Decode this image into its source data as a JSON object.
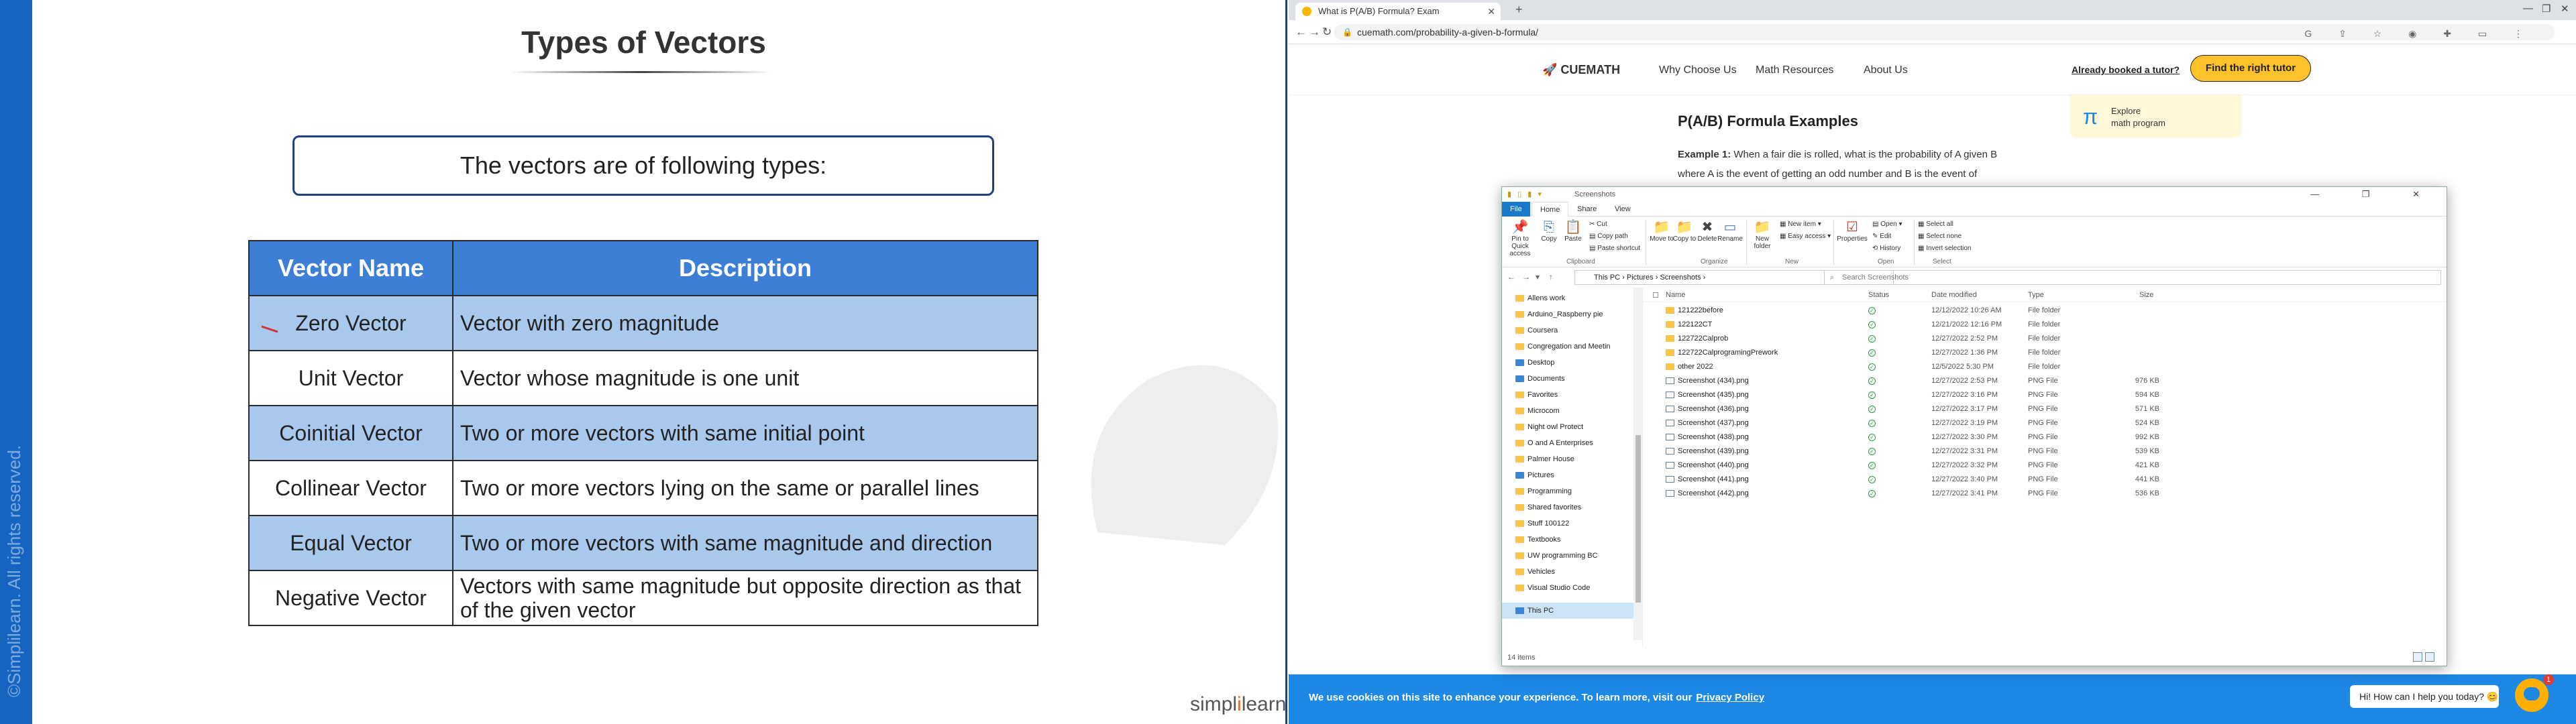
{
  "slide": {
    "title": "Types of Vectors",
    "intro": "The vectors are of following types:",
    "headers": [
      "Vector Name",
      "Description"
    ],
    "rows": [
      {
        "name": "Zero Vector",
        "desc": "Vector with zero magnitude"
      },
      {
        "name": "Unit Vector",
        "desc": "Vector whose magnitude is one unit"
      },
      {
        "name": "Coinitial Vector",
        "desc": "Two or more vectors with same initial point"
      },
      {
        "name": "Collinear Vector",
        "desc": "Two or more vectors lying on the same or parallel lines"
      },
      {
        "name": "Equal Vector",
        "desc": "Two or more vectors with same magnitude and direction"
      },
      {
        "name": "Negative Vector",
        "desc": "Vectors with same magnitude but opposite direction as that of the given vector"
      }
    ],
    "watermark": "©Simplilearn. All rights reserved.",
    "logo_a": "simpl",
    "logo_b": "i",
    "logo_c": "learn",
    "colors": {
      "header": "#3d7fd6",
      "shade": "#a8c8ec",
      "band": "#1565c0"
    }
  },
  "browser": {
    "tab_title": "What is P(A/B) Formula? Exam",
    "url": "cuemath.com/probability-a-given-b-formula/",
    "site": {
      "logo": "CUEMATH",
      "nav": [
        "Why Choose Us",
        "Math Resources",
        "About Us"
      ],
      "booked_link": "Already booked a tutor?",
      "cta": "Find the right tutor",
      "explore_1": "Explore",
      "explore_2": "math program",
      "heading": "P(A/B) Formula Examples",
      "example_label": "Example 1:",
      "example_text": "When a fair die is rolled, what is the probability of A given B where A is the event of getting an odd number and B is the event of"
    },
    "cookie_msg": "We use cookies on this site to enhance your experience. To learn more, visit our",
    "cookie_link": "Privacy Policy",
    "chat_prompt": "Hi! How can I help you today? 😊",
    "chat_badge": "1"
  },
  "explorer": {
    "title": "Screenshots",
    "ribbon_tabs": [
      "File",
      "Home",
      "Share",
      "View"
    ],
    "ribbon": {
      "pin": "Pin to Quick access",
      "copy": "Copy",
      "paste": "Paste",
      "cut": "Cut",
      "copy_path": "Copy path",
      "paste_shortcut": "Paste shortcut",
      "move_to": "Move to",
      "copy_to": "Copy to",
      "delete": "Delete",
      "rename": "Rename",
      "new_folder": "New folder",
      "new_item": "New item",
      "easy_access": "Easy access",
      "properties": "Properties",
      "open": "Open",
      "edit": "Edit",
      "history": "History",
      "select_all": "Select all",
      "select_none": "Select none",
      "invert": "Invert selection",
      "groups": [
        "Clipboard",
        "Organize",
        "New",
        "Open",
        "Select"
      ]
    },
    "path": [
      "This PC",
      "Pictures",
      "Screenshots"
    ],
    "search_placeholder": "Search Screenshots",
    "nav_items": [
      {
        "label": "Allens work",
        "icon": "folder"
      },
      {
        "label": "Arduino_Raspberry pie",
        "icon": "folder"
      },
      {
        "label": "Coursera",
        "icon": "folder"
      },
      {
        "label": "Congregation and Meetin",
        "icon": "folder"
      },
      {
        "label": "Desktop",
        "icon": "desktop"
      },
      {
        "label": "Documents",
        "icon": "documents"
      },
      {
        "label": "Favorites",
        "icon": "folder"
      },
      {
        "label": "Microcom",
        "icon": "folder"
      },
      {
        "label": "Night owl Protect",
        "icon": "folder"
      },
      {
        "label": "O and A Enterprises",
        "icon": "folder"
      },
      {
        "label": "Palmer House",
        "icon": "folder"
      },
      {
        "label": "Pictures",
        "icon": "pictures"
      },
      {
        "label": "Programming",
        "icon": "folder"
      },
      {
        "label": "Shared favorites",
        "icon": "folder"
      },
      {
        "label": "Stuff 100122",
        "icon": "folder"
      },
      {
        "label": "Textbooks",
        "icon": "folder"
      },
      {
        "label": "UW programming BC",
        "icon": "folder"
      },
      {
        "label": "Vehicles",
        "icon": "folder"
      },
      {
        "label": "Visual Studio Code",
        "icon": "folder"
      },
      {
        "label": "This PC",
        "icon": "pc"
      }
    ],
    "columns": [
      "Name",
      "Status",
      "Date modified",
      "Type",
      "Size"
    ],
    "files": [
      {
        "name": "121222before",
        "date": "12/12/2022 10:26 AM",
        "type": "File folder",
        "size": "",
        "kind": "folder"
      },
      {
        "name": "122122CT",
        "date": "12/21/2022 12:16 PM",
        "type": "File folder",
        "size": "",
        "kind": "folder"
      },
      {
        "name": "122722Calprob",
        "date": "12/27/2022 2:52 PM",
        "type": "File folder",
        "size": "",
        "kind": "folder"
      },
      {
        "name": "122722CalprogramingPrework",
        "date": "12/27/2022 1:36 PM",
        "type": "File folder",
        "size": "",
        "kind": "folder"
      },
      {
        "name": "other 2022",
        "date": "12/5/2022 5:30 PM",
        "type": "File folder",
        "size": "",
        "kind": "folder"
      },
      {
        "name": "Screenshot (434).png",
        "date": "12/27/2022 2:53 PM",
        "type": "PNG File",
        "size": "976 KB",
        "kind": "png"
      },
      {
        "name": "Screenshot (435).png",
        "date": "12/27/2022 3:16 PM",
        "type": "PNG File",
        "size": "594 KB",
        "kind": "png"
      },
      {
        "name": "Screenshot (436).png",
        "date": "12/27/2022 3:17 PM",
        "type": "PNG File",
        "size": "571 KB",
        "kind": "png"
      },
      {
        "name": "Screenshot (437).png",
        "date": "12/27/2022 3:19 PM",
        "type": "PNG File",
        "size": "524 KB",
        "kind": "png"
      },
      {
        "name": "Screenshot (438).png",
        "date": "12/27/2022 3:30 PM",
        "type": "PNG File",
        "size": "992 KB",
        "kind": "png"
      },
      {
        "name": "Screenshot (439).png",
        "date": "12/27/2022 3:31 PM",
        "type": "PNG File",
        "size": "539 KB",
        "kind": "png"
      },
      {
        "name": "Screenshot (440).png",
        "date": "12/27/2022 3:32 PM",
        "type": "PNG File",
        "size": "421 KB",
        "kind": "png"
      },
      {
        "name": "Screenshot (441).png",
        "date": "12/27/2022 3:40 PM",
        "type": "PNG File",
        "size": "441 KB",
        "kind": "png"
      },
      {
        "name": "Screenshot (442).png",
        "date": "12/27/2022 3:41 PM",
        "type": "PNG File",
        "size": "536 KB",
        "kind": "png"
      }
    ],
    "status": "14 items"
  }
}
